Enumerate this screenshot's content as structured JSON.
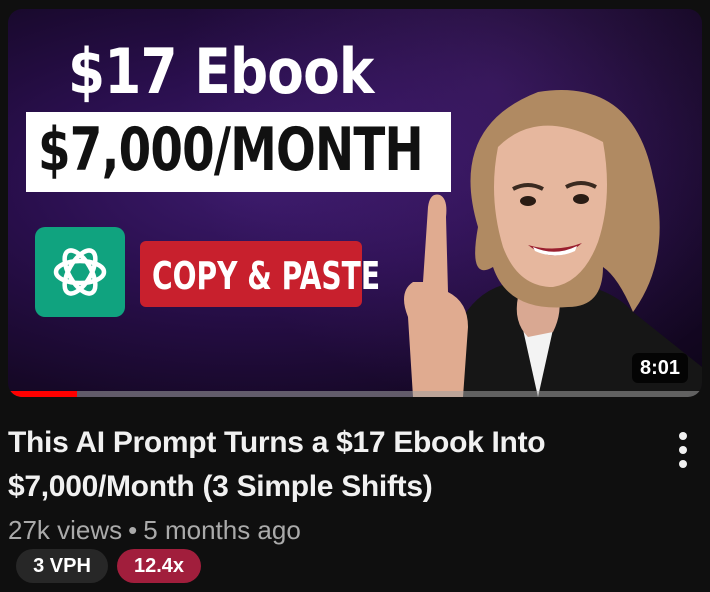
{
  "video": {
    "thumbnail": {
      "headline_top": "$17 Ebook",
      "headline_bottom": "$7,000/MONTH",
      "badge_text": "COPY & PASTE",
      "logo_icon": "chatgpt-logo-icon",
      "duration": "8:01",
      "watch_progress": 0.1,
      "colors": {
        "background": "#2a0f4e",
        "logo_tile": "#10a37f",
        "badge": "#c8202d",
        "progress": "#ff0000"
      }
    },
    "title": "This AI Prompt Turns a $17 Ebook Into $7,000/Month (3 Simple Shifts)",
    "views": "27k views",
    "separator": "•",
    "age": "5 months ago",
    "menu_icon": "more-vertical-icon"
  },
  "badges": {
    "vph": "3 VPH",
    "multiplier": "12.4x",
    "colors": {
      "vph": "#272727",
      "multiplier": "#a11e3c"
    }
  }
}
